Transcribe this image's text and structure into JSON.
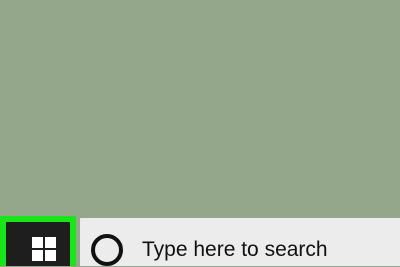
{
  "desktop": {
    "background_color": "#94a78a"
  },
  "taskbar": {
    "start_button": {
      "icon": "windows-logo-icon",
      "highlight_color": "#19e619"
    },
    "search": {
      "icon": "cortana-circle-icon",
      "placeholder": "Type here to search"
    }
  }
}
